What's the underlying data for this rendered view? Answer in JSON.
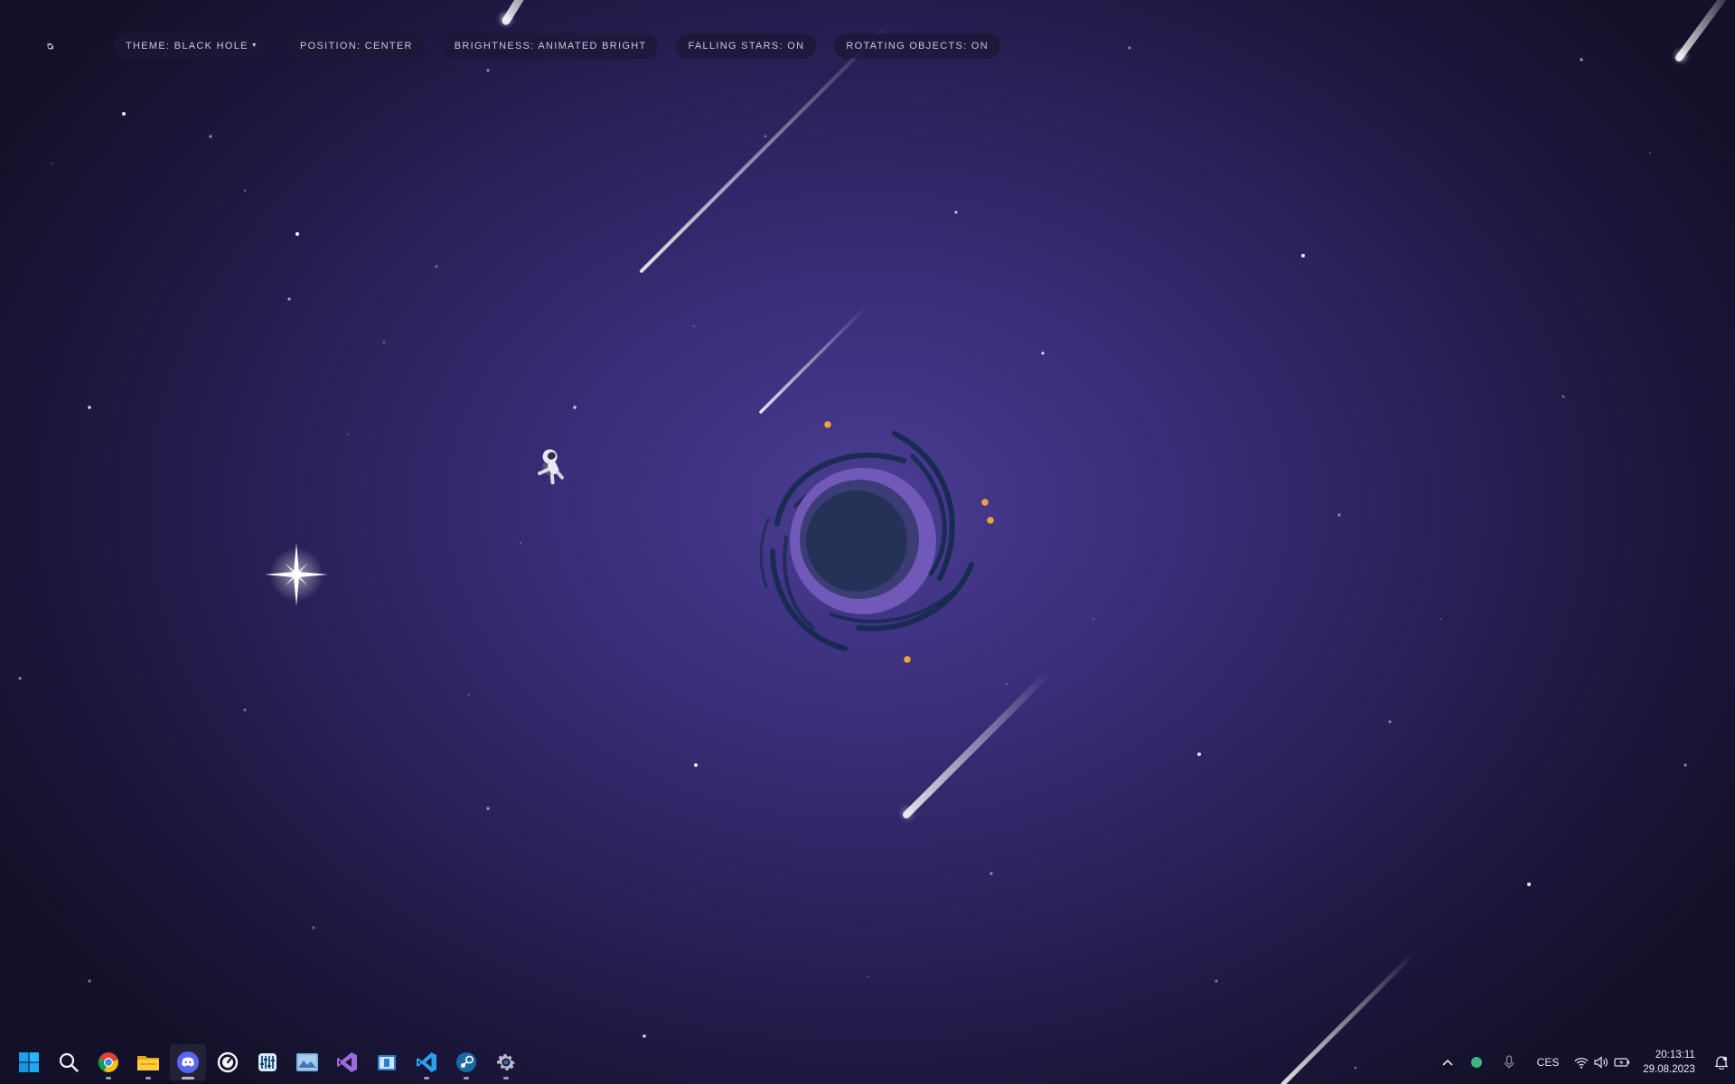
{
  "settings_bar": {
    "gear_icon": "gear-icon",
    "theme_label": "THEME: BLACK HOLE",
    "position_label": "POSITION: CENTER",
    "brightness_label": "BRIGHTNESS: ANIMATED BRIGHT",
    "falling_stars_label": "FALLING STARS: ON",
    "rotating_objects_label": "ROTATING OBJECTS: ON"
  },
  "scene": {
    "colors": {
      "sky_center": "#4b3d92",
      "sky_edge": "#131129",
      "ring": "#7059b8",
      "core": "#263158",
      "swirl": "#13294a",
      "particles": "#e8a53a"
    },
    "objects": [
      "black-hole",
      "astronaut",
      "four-point-star",
      "falling-stars",
      "background-stars"
    ]
  },
  "taskbar": {
    "apps": [
      {
        "name": "start",
        "icon": "windows-start-icon",
        "running": false
      },
      {
        "name": "search",
        "icon": "search-icon",
        "running": false
      },
      {
        "name": "chrome",
        "icon": "chrome-icon",
        "running": true
      },
      {
        "name": "file-explorer",
        "icon": "folder-icon",
        "running": true
      },
      {
        "name": "discord",
        "icon": "discord-icon",
        "running": true
      },
      {
        "name": "speedometer",
        "icon": "speedometer-icon",
        "running": false
      },
      {
        "name": "equalizer",
        "icon": "equalizer-icon",
        "running": false
      },
      {
        "name": "photos",
        "icon": "photo-icon",
        "running": false
      },
      {
        "name": "visual-studio",
        "icon": "visual-studio-icon",
        "running": false
      },
      {
        "name": "microsoft-store",
        "icon": "store-icon",
        "running": false
      },
      {
        "name": "vs-code",
        "icon": "vscode-icon",
        "running": true
      },
      {
        "name": "steam",
        "icon": "steam-icon",
        "running": true
      },
      {
        "name": "settings",
        "icon": "settings-icon",
        "running": true
      }
    ],
    "tray": {
      "chevron": "chevron-up-icon",
      "status_dot": "status-dot-icon",
      "mic": "microphone-icon",
      "language": "CES",
      "wifi": "wifi-icon",
      "volume": "volume-icon",
      "battery": "battery-icon",
      "time": "20:13:11",
      "date": "29.08.2023",
      "notifications": "notification-bell-icon"
    }
  }
}
